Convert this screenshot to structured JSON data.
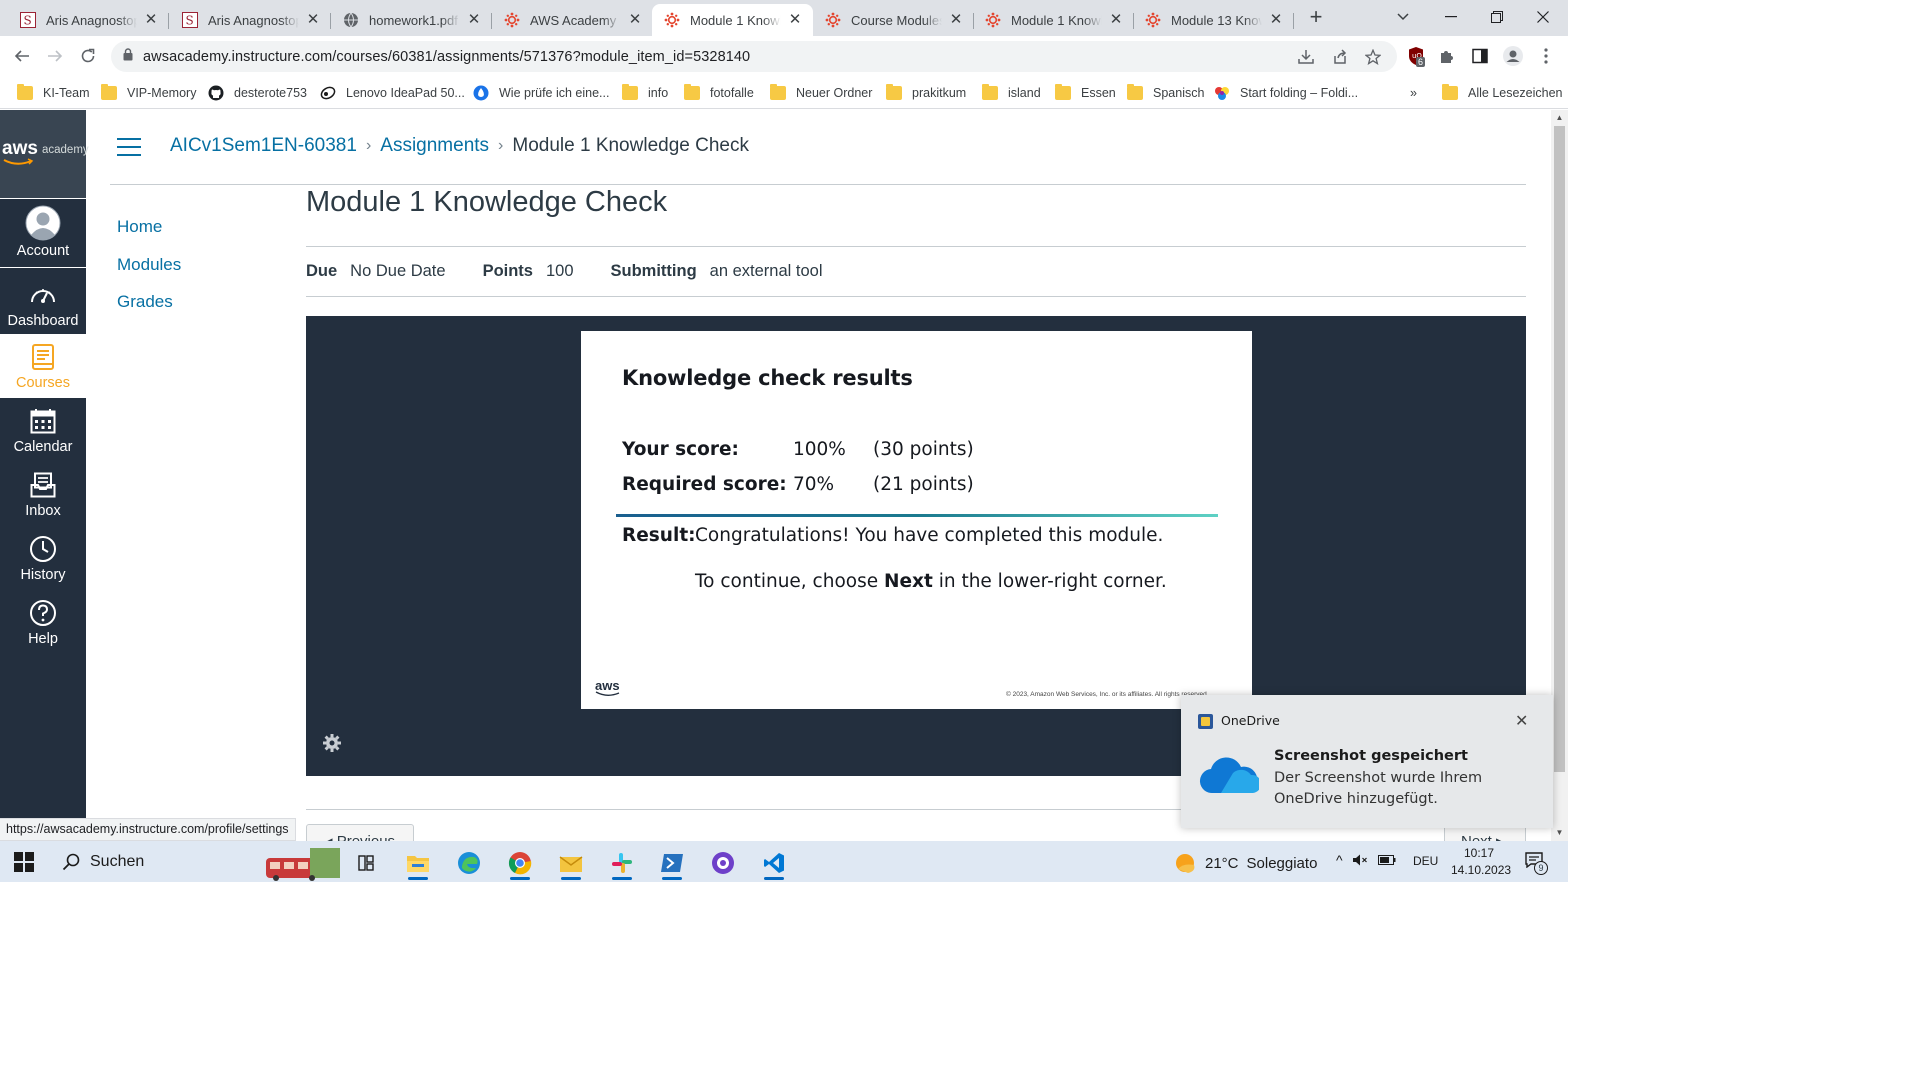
{
  "browser": {
    "tabs": [
      {
        "title": "Aris Anagnostop",
        "icon": "scribd-s-icon",
        "active": false
      },
      {
        "title": "Aris Anagnostop",
        "icon": "scribd-s-icon",
        "active": false
      },
      {
        "title": "homework1.pdf",
        "icon": "globe-icon",
        "active": false
      },
      {
        "title": "AWS Academy In",
        "icon": "canvas-icon",
        "active": false
      },
      {
        "title": "Module 1 Knowle",
        "icon": "canvas-icon",
        "active": true
      },
      {
        "title": "Course Modules",
        "icon": "canvas-icon",
        "active": false
      },
      {
        "title": "Module 1 Knowle",
        "icon": "canvas-icon",
        "active": false
      },
      {
        "title": "Module 13 Know",
        "icon": "canvas-icon",
        "active": false
      }
    ],
    "url": "awsacademy.instructure.com/courses/60381/assignments/571376?module_item_id=5328140",
    "extension_badge": "6",
    "bookmarks": [
      {
        "label": "KI-Team",
        "icon": "folder-icon"
      },
      {
        "label": "VIP-Memory",
        "icon": "folder-icon"
      },
      {
        "label": "desterote753",
        "icon": "github-icon"
      },
      {
        "label": "Lenovo IdeaPad 50...",
        "icon": "lenovo-icon"
      },
      {
        "label": "Wie prüfe ich eine...",
        "icon": "water-drop-icon"
      },
      {
        "label": "info",
        "icon": "folder-icon"
      },
      {
        "label": "fotofalle",
        "icon": "folder-icon"
      },
      {
        "label": "Neuer Ordner",
        "icon": "folder-icon"
      },
      {
        "label": "prakitkum",
        "icon": "folder-icon"
      },
      {
        "label": "island",
        "icon": "folder-icon"
      },
      {
        "label": "Essen",
        "icon": "folder-icon"
      },
      {
        "label": "Spanisch",
        "icon": "folder-icon"
      },
      {
        "label": "Start folding – Foldi...",
        "icon": "folding-icon"
      }
    ],
    "bookmarks_overflow": "»",
    "all_bookmarks": "Alle Lesezeichen",
    "status_url": "https://awsacademy.instructure.com/profile/settings"
  },
  "globalnav": {
    "logo_text": "aws",
    "logo_sub": "academy",
    "items": [
      {
        "label": "Account",
        "icon": "account-icon"
      },
      {
        "label": "Dashboard",
        "icon": "dashboard-icon"
      },
      {
        "label": "Courses",
        "icon": "courses-icon"
      },
      {
        "label": "Calendar",
        "icon": "calendar-icon"
      },
      {
        "label": "Inbox",
        "icon": "inbox-icon"
      },
      {
        "label": "History",
        "icon": "history-icon"
      },
      {
        "label": "Help",
        "icon": "help-icon"
      }
    ]
  },
  "breadcrumb": {
    "course": "AICv1Sem1EN-60381",
    "section": "Assignments",
    "current": "Module 1 Knowledge Check"
  },
  "coursenav": [
    "Home",
    "Modules",
    "Grades"
  ],
  "assignment": {
    "title": "Module 1 Knowledge Check",
    "due_label": "Due",
    "due_value": "No Due Date",
    "points_label": "Points",
    "points_value": "100",
    "submitting_label": "Submitting",
    "submitting_value": "an external tool"
  },
  "results": {
    "heading": "Knowledge check results",
    "your_score_label": "Your score:",
    "your_score_pct": "100%",
    "your_score_points": "(30 points)",
    "required_label": "Required score:",
    "required_pct": "70%",
    "required_points": "(21 points)",
    "result_label": "Result:",
    "result_msg": "Congratulations! You have completed this module.",
    "continue_pre": "To continue, choose ",
    "continue_bold": "Next",
    "continue_post": " in the lower-right corner.",
    "footer_logo": "aws",
    "copyright": "© 2023, Amazon Web Services, Inc. or its affiliates. All rights reserved."
  },
  "pager": {
    "previous": "◂ Previous",
    "next": "Next ▸"
  },
  "toast": {
    "app": "OneDrive",
    "title": "Screenshot gespeichert",
    "body": "Der Screenshot wurde Ihrem OneDrive hinzugefügt.",
    "close": "✕"
  },
  "taskbar": {
    "search": "Suchen",
    "weather_temp": "21°C",
    "weather_text": "Soleggiato",
    "language": "DEU",
    "time": "10:17",
    "date": "14.10.2023",
    "notification_count": "9"
  },
  "colors": {
    "canvas_nav": "#232f3e",
    "link": "#0770a3",
    "active_nav": "#f5a623",
    "tool_frame": "#232f3e"
  }
}
